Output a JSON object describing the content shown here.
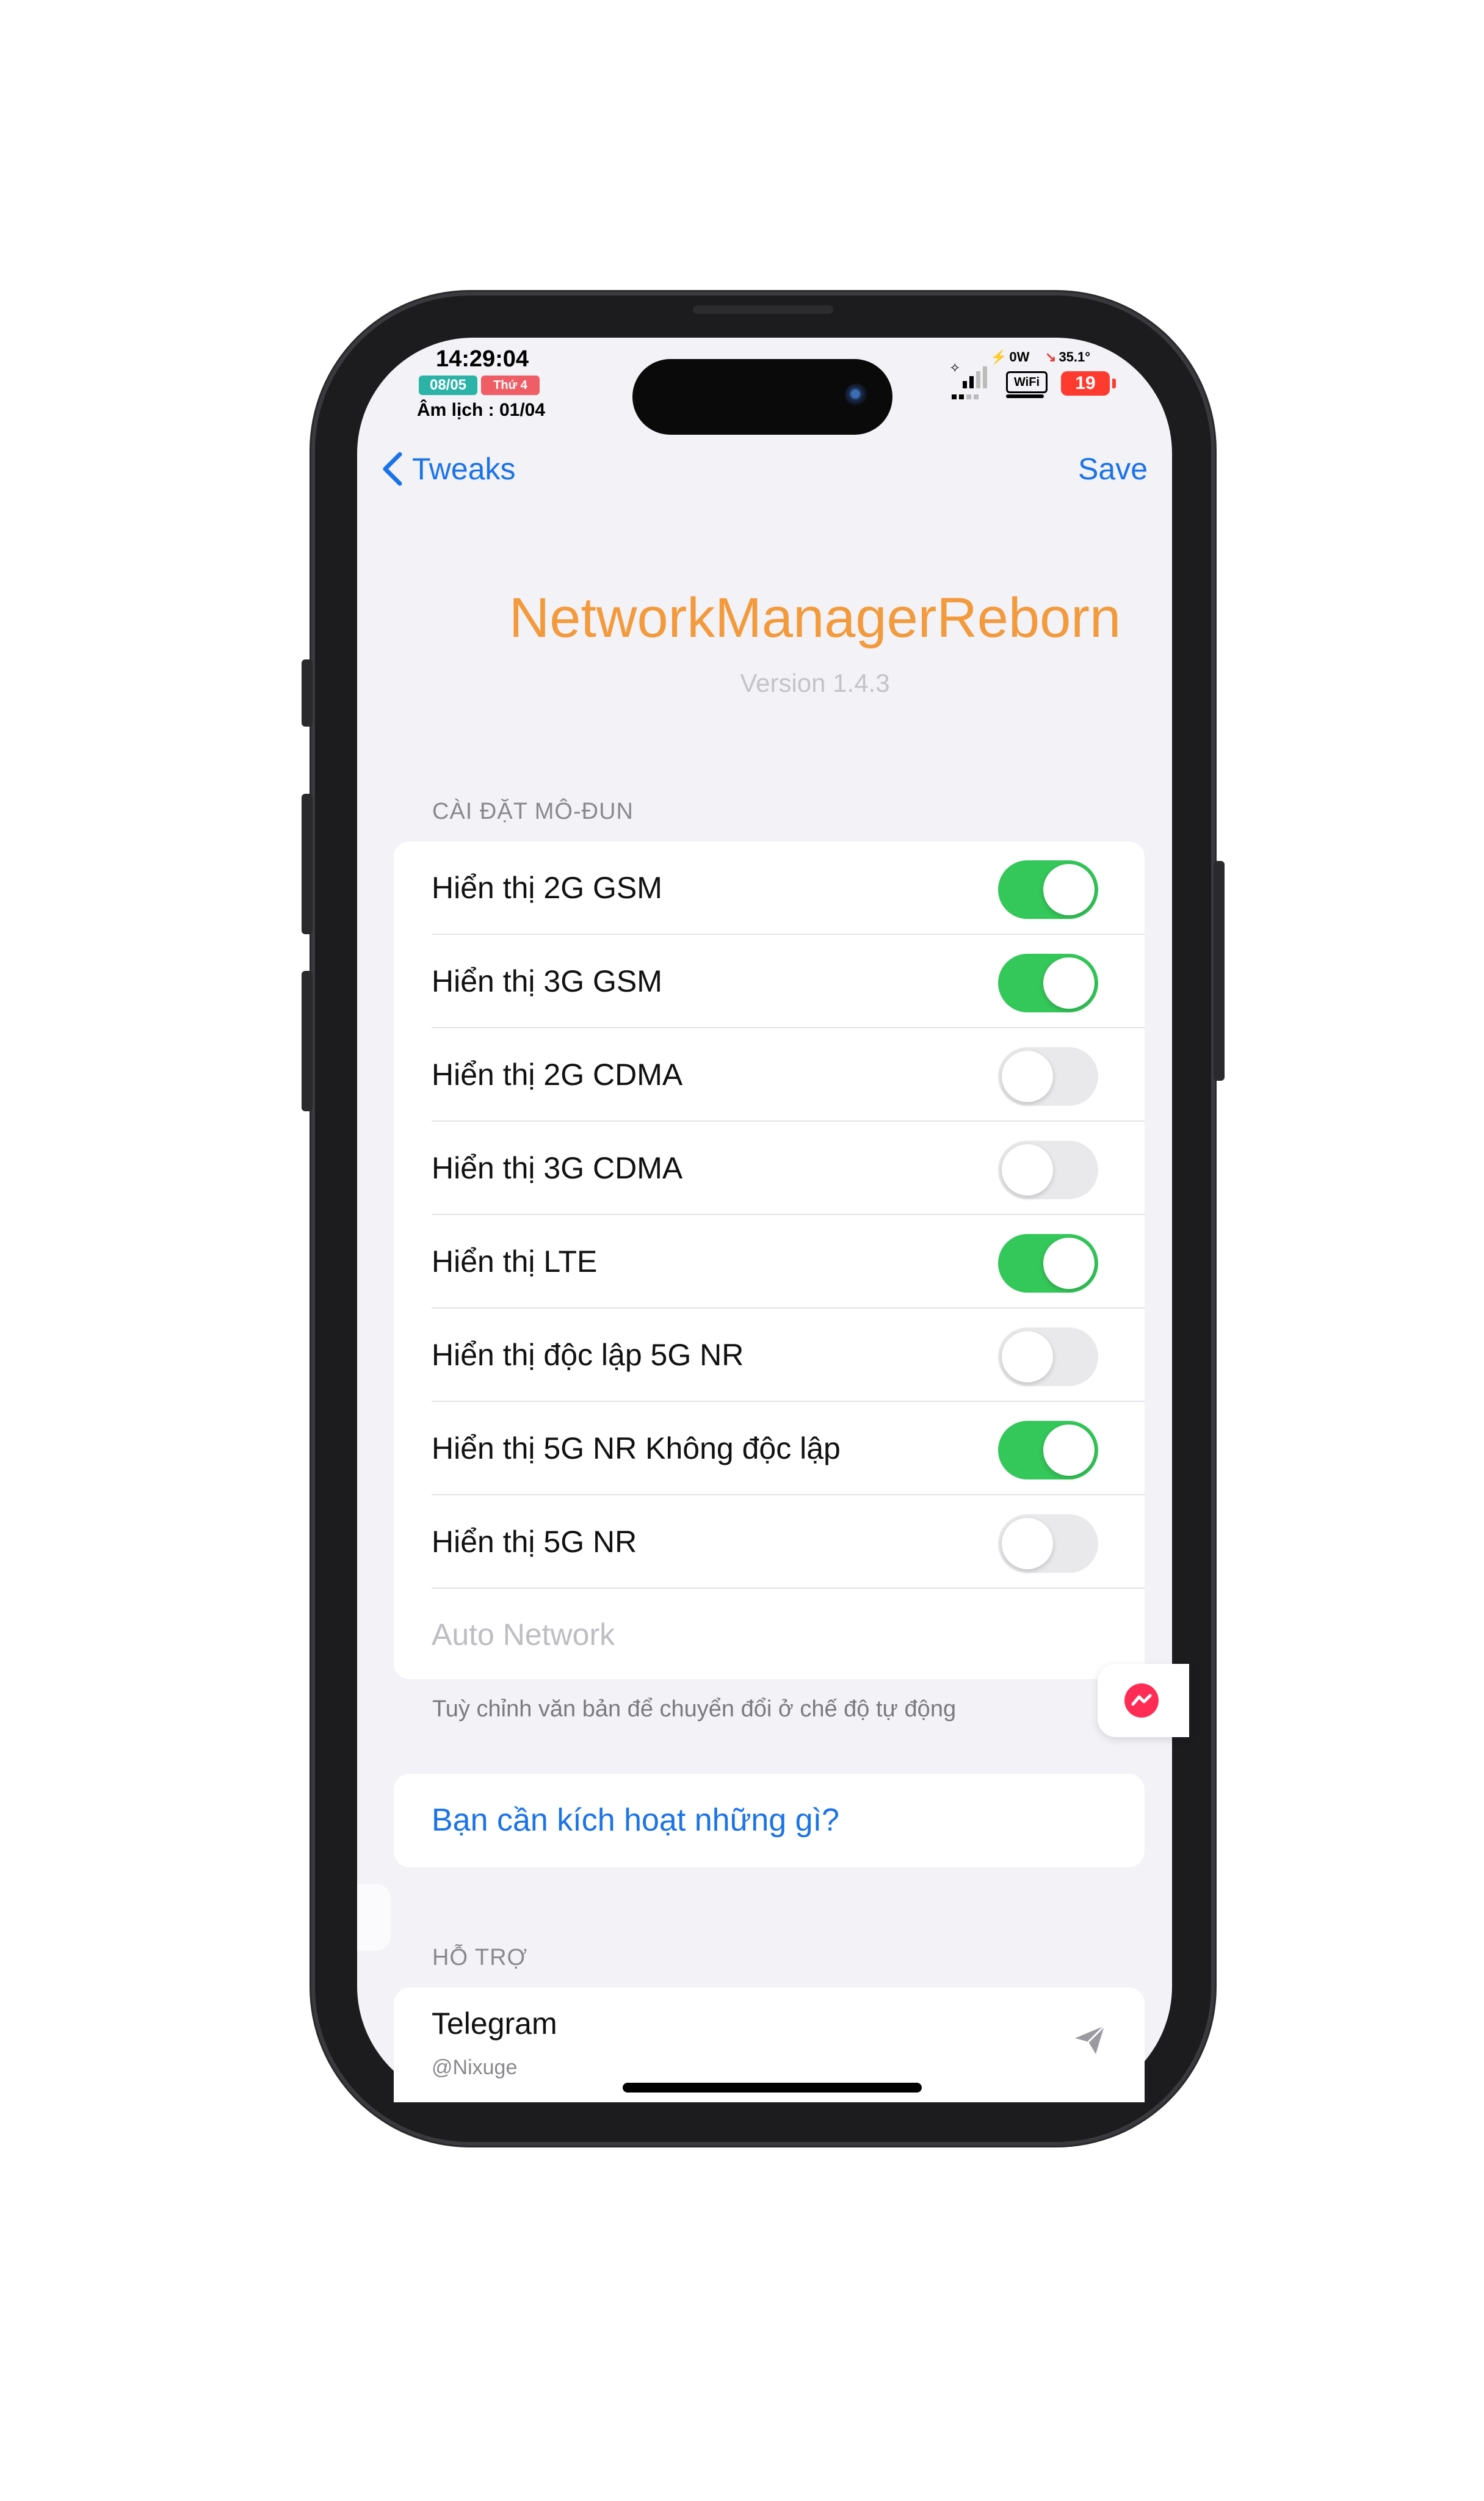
{
  "status_bar": {
    "time": "14:29:04",
    "date_badge": "08/05",
    "weekday_badge": "Thứ 4",
    "lunar": "Âm lịch : 01/04",
    "power": "0W",
    "temperature": "35.1°",
    "wifi_label": "WiFi",
    "battery": "19"
  },
  "nav": {
    "back_label": "Tweaks",
    "save_label": "Save"
  },
  "header": {
    "title": "NetworkManagerReborn",
    "version": "Version 1.4.3"
  },
  "module_section": {
    "heading": "CÀI ĐẶT MÔ-ĐUN",
    "rows": [
      {
        "label": "Hiển thị 2G GSM",
        "enabled": true
      },
      {
        "label": "Hiển thị 3G GSM",
        "enabled": true
      },
      {
        "label": "Hiển thị 2G CDMA",
        "enabled": false
      },
      {
        "label": "Hiển thị 3G CDMA",
        "enabled": false
      },
      {
        "label": "Hiển thị LTE",
        "enabled": true
      },
      {
        "label": "Hiển thị độc lập 5G NR",
        "enabled": false
      },
      {
        "label": "Hiển thị 5G NR Không độc lập",
        "enabled": true
      },
      {
        "label": "Hiển thị 5G NR",
        "enabled": false
      }
    ],
    "auto_network_placeholder": "Auto Network",
    "footnote": "Tuỳ chỉnh văn bản để chuyển đổi ở chế độ tự động"
  },
  "activation": {
    "link_label": "Bạn cần kích hoạt những gì?"
  },
  "support_section": {
    "heading": "HỖ TRỢ",
    "telegram_title": "Telegram",
    "telegram_handle": "@Nixuge"
  },
  "colors": {
    "accent": "#1a73e8",
    "title": "#f39a3c",
    "toggle_on": "#34c759",
    "toggle_off": "#e9e9eb",
    "background": "#f2f2f7"
  }
}
